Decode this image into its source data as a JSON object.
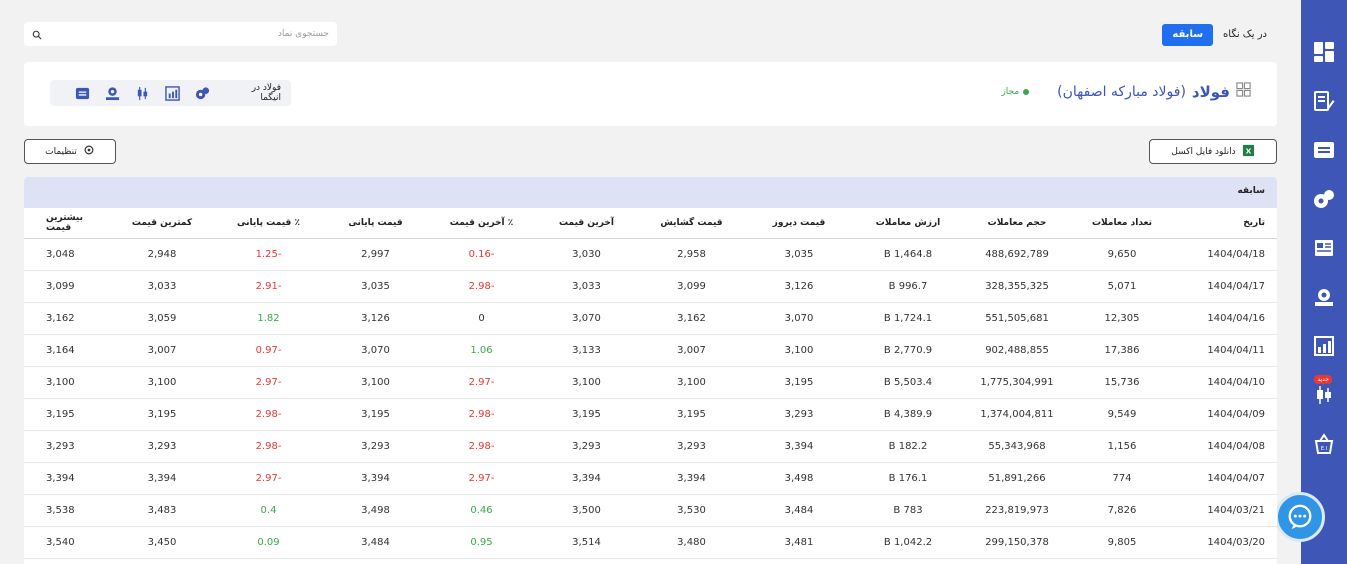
{
  "tabs": {
    "history": "سابقه",
    "overview": "در یک نگاه"
  },
  "search": {
    "placeholder": "جستجوی نماد"
  },
  "symbol": {
    "name": "فولاد",
    "full_name": "(فولاد مبارکه اصفهان)",
    "status": "مجاز",
    "status_color": "#3aa84a"
  },
  "tools": {
    "inegma_label": "فولاد در انیگما"
  },
  "actions": {
    "excel_label": "دانلود فایل اکسل",
    "settings_label": "تنظیمات"
  },
  "sidebar": {
    "new_badge": "جدید"
  },
  "table": {
    "title": "سابقه",
    "headers": {
      "date": "تاریخ",
      "trades": "تعداد معاملات",
      "volume": "حجم معاملات",
      "value": "ارزش معاملات",
      "yesterday": "قیمت دیروز",
      "open": "قیمت گشایش",
      "last": "آخرین قیمت",
      "last_pct": "٪ آخرین قیمت",
      "close": "قیمت پایانی",
      "close_pct": "٪ قیمت پایانی",
      "min": "کمترین قیمت",
      "max": "بیشترین قیمت"
    },
    "rows": [
      {
        "date": "1404/04/18",
        "trades": "9,650",
        "volume": "488,692,789",
        "value": "1,464.8 B",
        "yesterday": "3,035",
        "open": "2,958",
        "last": "3,030",
        "last_pct": "-0.16",
        "close": "2,997",
        "close_pct": "-1.25",
        "min": "2,948",
        "max": "3,048"
      },
      {
        "date": "1404/04/17",
        "trades": "5,071",
        "volume": "328,355,325",
        "value": "996.7 B",
        "yesterday": "3,126",
        "open": "3,099",
        "last": "3,033",
        "last_pct": "-2.98",
        "close": "3,035",
        "close_pct": "-2.91",
        "min": "3,033",
        "max": "3,099"
      },
      {
        "date": "1404/04/16",
        "trades": "12,305",
        "volume": "551,505,681",
        "value": "1,724.1 B",
        "yesterday": "3,070",
        "open": "3,162",
        "last": "3,070",
        "last_pct": "0",
        "close": "3,126",
        "close_pct": "1.82",
        "min": "3,059",
        "max": "3,162"
      },
      {
        "date": "1404/04/11",
        "trades": "17,386",
        "volume": "902,488,855",
        "value": "2,770.9 B",
        "yesterday": "3,100",
        "open": "3,007",
        "last": "3,133",
        "last_pct": "1.06",
        "close": "3,070",
        "close_pct": "-0.97",
        "min": "3,007",
        "max": "3,164"
      },
      {
        "date": "1404/04/10",
        "trades": "15,736",
        "volume": "1,775,304,991",
        "value": "5,503.4 B",
        "yesterday": "3,195",
        "open": "3,100",
        "last": "3,100",
        "last_pct": "-2.97",
        "close": "3,100",
        "close_pct": "-2.97",
        "min": "3,100",
        "max": "3,100"
      },
      {
        "date": "1404/04/09",
        "trades": "9,549",
        "volume": "1,374,004,811",
        "value": "4,389.9 B",
        "yesterday": "3,293",
        "open": "3,195",
        "last": "3,195",
        "last_pct": "-2.98",
        "close": "3,195",
        "close_pct": "-2.98",
        "min": "3,195",
        "max": "3,195"
      },
      {
        "date": "1404/04/08",
        "trades": "1,156",
        "volume": "55,343,968",
        "value": "182.2 B",
        "yesterday": "3,394",
        "open": "3,293",
        "last": "3,293",
        "last_pct": "-2.98",
        "close": "3,293",
        "close_pct": "-2.98",
        "min": "3,293",
        "max": "3,293"
      },
      {
        "date": "1404/04/07",
        "trades": "774",
        "volume": "51,891,266",
        "value": "176.1 B",
        "yesterday": "3,498",
        "open": "3,394",
        "last": "3,394",
        "last_pct": "-2.97",
        "close": "3,394",
        "close_pct": "-2.97",
        "min": "3,394",
        "max": "3,394"
      },
      {
        "date": "1404/03/21",
        "trades": "7,826",
        "volume": "223,819,973",
        "value": "783 B",
        "yesterday": "3,484",
        "open": "3,530",
        "last": "3,500",
        "last_pct": "0.46",
        "close": "3,498",
        "close_pct": "0.4",
        "min": "3,483",
        "max": "3,538"
      },
      {
        "date": "1404/03/20",
        "trades": "9,805",
        "volume": "299,150,378",
        "value": "1,042.2 B",
        "yesterday": "3,481",
        "open": "3,480",
        "last": "3,514",
        "last_pct": "0.95",
        "close": "3,484",
        "close_pct": "0.09",
        "min": "3,450",
        "max": "3,540"
      }
    ]
  },
  "colors": {
    "brand": "#3e56b5",
    "accent": "#1f6ff0",
    "negative": "#e53935",
    "positive": "#3aa84a",
    "page_bg": "#f2f2f2",
    "table_header_bg": "#dde3f5"
  }
}
